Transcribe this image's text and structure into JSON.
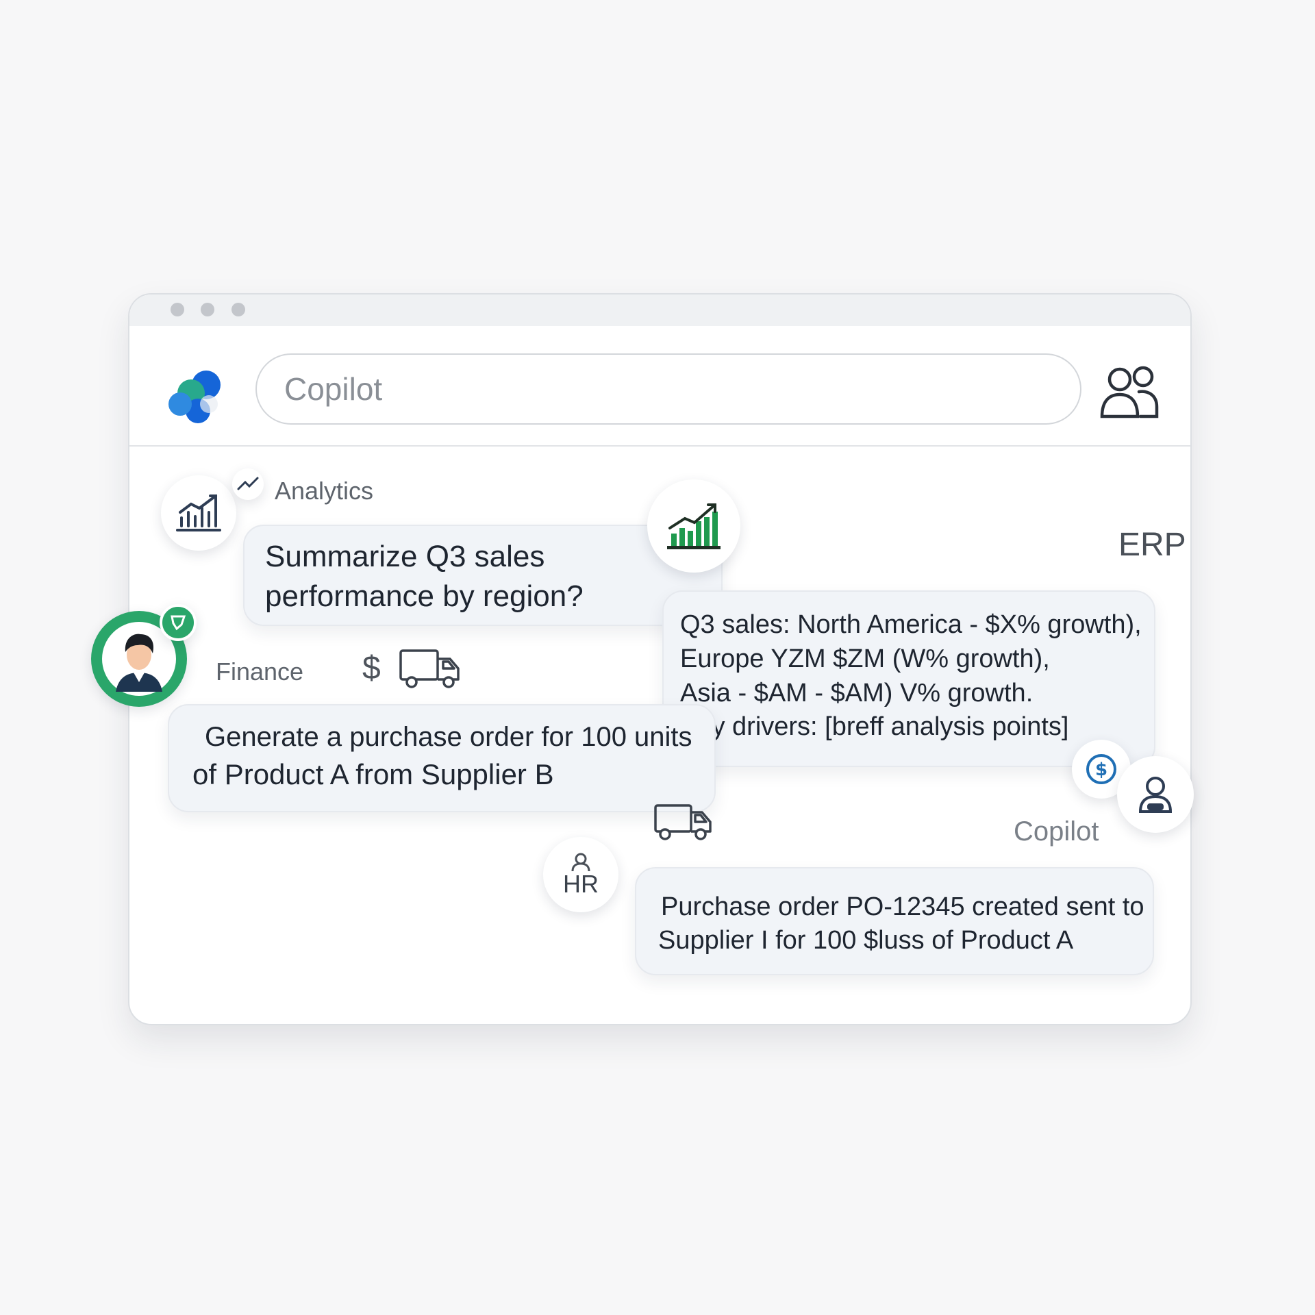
{
  "window": {
    "dots": [
      "window-dot",
      "window-dot",
      "window-dot"
    ]
  },
  "header": {
    "search_placeholder": "Copilot"
  },
  "labels": {
    "analytics": "Analytics",
    "finance": "Finance",
    "dollar": "$",
    "erp": "ERP",
    "copilot": "Copilot",
    "hr": "HR"
  },
  "messages": {
    "analytics_query": [
      "Summarize Q3 sales",
      "performance by region?"
    ],
    "erp_response": [
      "Q3 sales: North America - $X% growth),",
      "Europe YZM $ZM (W% growth),",
      "Asia - $AM - $AM) V% growth.",
      "Key drivers: [breff analysis points]"
    ],
    "finance_query": [
      "Generate a purchase order for 100 units",
      "of Product A from Supplier B"
    ],
    "copilot_response": [
      "Purchase order PO-12345 created sent to",
      "Supplier I for 100 $luss of Product A"
    ]
  },
  "colors": {
    "accent_green": "#2aa66a",
    "chart_green": "#1f9a4e",
    "brand_blue": "#1565d8",
    "brand_teal": "#28a98c",
    "dollar_blue": "#1f6fb5"
  },
  "icons": {
    "logo": "copilot-logo-icon",
    "people": "people-icon",
    "analytics": "bar-chart-icon",
    "trend": "trend-line-icon",
    "user_avatar": "user-avatar-icon",
    "truck": "truck-icon",
    "dollar": "dollar-coin-icon",
    "person": "person-icon"
  }
}
